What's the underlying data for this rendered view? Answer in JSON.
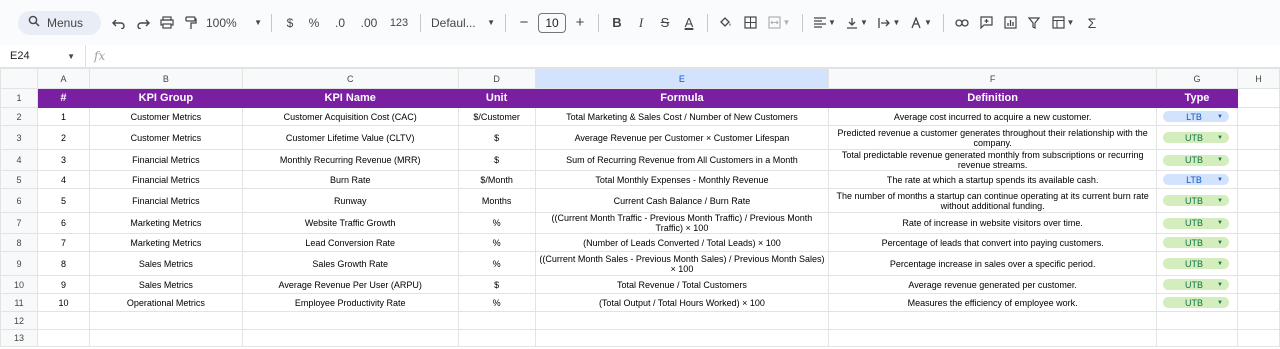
{
  "toolbar": {
    "menus_label": "Menus",
    "zoom": "100%",
    "currency": "$",
    "percent": "%",
    "decrease_decimal": ".0",
    "increase_decimal": ".00",
    "number_format": "123",
    "font": "Defaul...",
    "font_size": "10",
    "minus": "−",
    "plus": "+",
    "bold": "B",
    "italic": "I",
    "strike": "S",
    "text_color": "A",
    "highlight": "A",
    "sigma": "Σ"
  },
  "formula_bar": {
    "cell_ref": "E24",
    "fx": "fx"
  },
  "columns": [
    "A",
    "B",
    "C",
    "D",
    "E",
    "F",
    "G",
    "H"
  ],
  "rows_numbers": [
    "1",
    "2",
    "3",
    "4",
    "5",
    "6",
    "7",
    "8",
    "9",
    "10",
    "11",
    "12",
    "13"
  ],
  "headers": [
    "#",
    "KPI Group",
    "KPI Name",
    "Unit",
    "Formula",
    "Definition",
    "Type"
  ],
  "rows": [
    {
      "num": "1",
      "group": "Customer Metrics",
      "name": "Customer Acquisition Cost (CAC)",
      "unit": "$/Customer",
      "formula": "Total Marketing & Sales Cost / Number of New Customers",
      "definition": "Average cost incurred to acquire a new customer.",
      "type": "LTB"
    },
    {
      "num": "2",
      "group": "Customer Metrics",
      "name": "Customer Lifetime Value (CLTV)",
      "unit": "$",
      "formula": "Average Revenue per Customer × Customer Lifespan",
      "definition": "Predicted revenue a customer generates throughout their relationship with the company.",
      "type": "UTB"
    },
    {
      "num": "3",
      "group": "Financial Metrics",
      "name": "Monthly Recurring Revenue (MRR)",
      "unit": "$",
      "formula": "Sum of Recurring Revenue from All Customers in a Month",
      "definition": "Total predictable revenue generated monthly from subscriptions or recurring revenue streams.",
      "type": "UTB"
    },
    {
      "num": "4",
      "group": "Financial Metrics",
      "name": "Burn Rate",
      "unit": "$/Month",
      "formula": "Total Monthly Expenses - Monthly Revenue",
      "definition": "The rate at which a startup spends its available cash.",
      "type": "LTB"
    },
    {
      "num": "5",
      "group": "Financial Metrics",
      "name": "Runway",
      "unit": "Months",
      "formula": "Current Cash Balance / Burn Rate",
      "definition": "The number of months a startup can continue operating at its current burn rate without additional funding.",
      "type": "UTB"
    },
    {
      "num": "6",
      "group": "Marketing Metrics",
      "name": "Website Traffic Growth",
      "unit": "%",
      "formula": "((Current Month Traffic - Previous Month Traffic) / Previous Month Traffic) × 100",
      "definition": "Rate of increase in website visitors over time.",
      "type": "UTB"
    },
    {
      "num": "7",
      "group": "Marketing Metrics",
      "name": "Lead Conversion Rate",
      "unit": "%",
      "formula": "(Number of Leads Converted / Total Leads) × 100",
      "definition": "Percentage of leads that convert into paying customers.",
      "type": "UTB"
    },
    {
      "num": "8",
      "group": "Sales Metrics",
      "name": "Sales Growth Rate",
      "unit": "%",
      "formula": "((Current Month Sales - Previous Month Sales) / Previous Month Sales) × 100",
      "definition": "Percentage increase in sales over a specific period.",
      "type": "UTB"
    },
    {
      "num": "9",
      "group": "Sales Metrics",
      "name": "Average Revenue Per User (ARPU)",
      "unit": "$",
      "formula": "Total Revenue / Total Customers",
      "definition": "Average revenue generated per customer.",
      "type": "UTB"
    },
    {
      "num": "10",
      "group": "Operational Metrics",
      "name": "Employee Productivity Rate",
      "unit": "%",
      "formula": "(Total Output / Total Hours Worked) × 100",
      "definition": "Measures the efficiency of employee work.",
      "type": "UTB"
    }
  ],
  "colors": {
    "header_bg": "#7b1fa2",
    "header_text": "#ffffff",
    "ltb_chip_bg": "#d3e3fd",
    "ltb_chip_text": "#0b57d0",
    "utb_chip_bg": "#d4edbc",
    "utb_chip_text": "#11734b",
    "selected_col_bg": "#d3e3fd"
  }
}
